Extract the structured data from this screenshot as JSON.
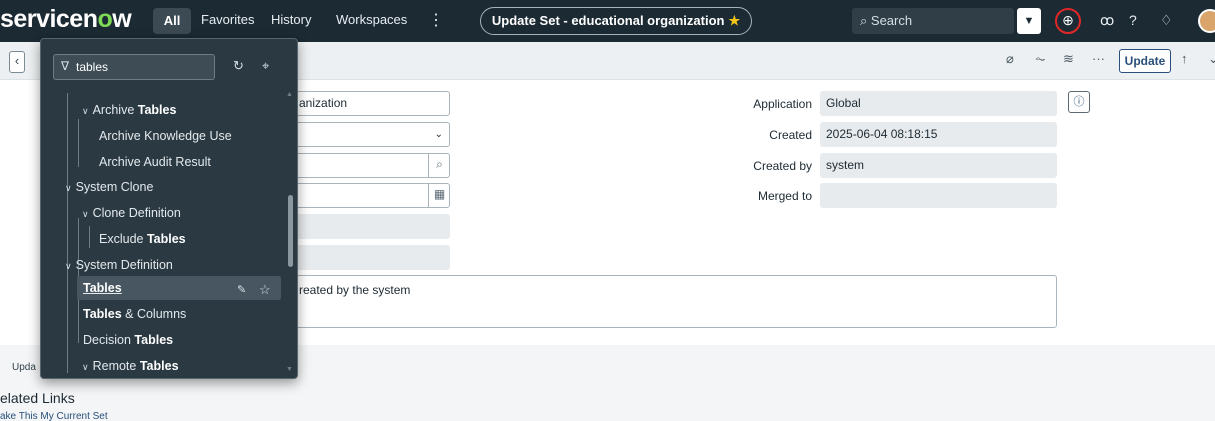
{
  "nav": {
    "logo": "servicenow",
    "logo_o": "o",
    "all": "All",
    "favorites": "Favorites",
    "history": "History",
    "workspaces": "Workspaces",
    "more": "⋮",
    "context": "Update Set - educational organization",
    "search_placeholder": "Search",
    "icons": [
      "globe-icon",
      "chat-icon",
      "help-icon",
      "bell-icon",
      "avatar"
    ]
  },
  "form_header": {
    "update_label": "Update",
    "icons": [
      "paperclip-icon",
      "activity-icon",
      "settings-icon",
      "more-icon",
      "arrow-up-icon",
      "chevron-down-icon"
    ]
  },
  "form": {
    "name_value": "anization",
    "application_label": "Application",
    "application_value": "Global",
    "created_label": "Created",
    "created_value": "2025-06-04 08:18:15",
    "created_by_label": "Created by",
    "created_by_value": "system",
    "merged_to_label": "Merged to",
    "merged_to_value": "",
    "description_value": "reated by the system",
    "info_icon": "ⓘ"
  },
  "bottom": {
    "tab_label": "Upda",
    "related_links": "elated Links",
    "make_current": "ake This My Current Set"
  },
  "filter_nav": {
    "filter_value": "tables",
    "items": [
      {
        "label_pre": "Archive ",
        "label_bold": "Tables",
        "label_post": "",
        "type": "section"
      },
      {
        "label_pre": "Archive Knowledge Use",
        "label_bold": "",
        "label_post": "",
        "type": "child"
      },
      {
        "label_pre": "Archive Audit Result",
        "label_bold": "",
        "label_post": "",
        "type": "child"
      },
      {
        "label_pre": "System Clone",
        "label_bold": "",
        "label_post": "",
        "type": "app"
      },
      {
        "label_pre": "Clone Definition",
        "label_bold": "",
        "label_post": "",
        "type": "section"
      },
      {
        "label_pre": "Exclude ",
        "label_bold": "Tables",
        "label_post": "",
        "type": "child"
      },
      {
        "label_pre": "System Definition",
        "label_bold": "",
        "label_post": "",
        "type": "app"
      },
      {
        "label_pre": "",
        "label_bold": "Tables",
        "label_post": "",
        "type": "module-active"
      },
      {
        "label_pre": "",
        "label_bold": "Tables",
        "label_post": " & Columns",
        "type": "module"
      },
      {
        "label_pre": "Decision ",
        "label_bold": "Tables",
        "label_post": "",
        "type": "module"
      },
      {
        "label_pre": "Remote ",
        "label_bold": "Tables",
        "label_post": "",
        "type": "section"
      }
    ]
  }
}
